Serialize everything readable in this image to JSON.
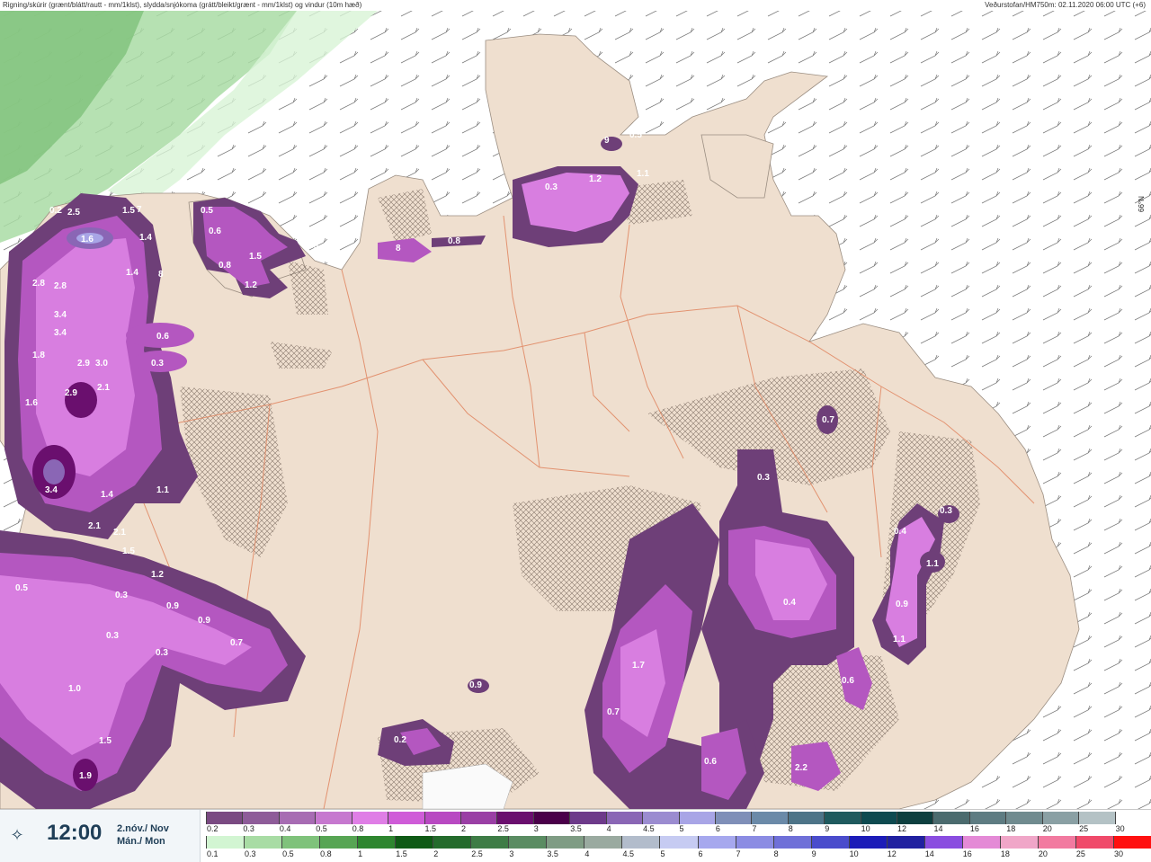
{
  "header": {
    "title": "Rigning/skúrir (grænt/blátt/rautt - mm/1klst), slydda/snjókoma (grátt/bleikt/grænt - mm/1klst) og vindur (10m hæð)",
    "source": "Veðurstofan/HM750m: 02.11.2020 06:00 UTC (+6)"
  },
  "time": {
    "icon": "clock-icon",
    "value": "12:00",
    "date_line1": "2.nóv./ Nov",
    "date_line2": "Mán./ Mon"
  },
  "lat_label": "66°N",
  "legend": {
    "snow": {
      "labels": [
        "0.2",
        "0.3",
        "0.4",
        "0.5",
        "0.8",
        "1",
        "1.5",
        "2",
        "2.5",
        "3",
        "3.5",
        "4",
        "4.5",
        "5",
        "6",
        "7",
        "8",
        "9",
        "10",
        "12",
        "14",
        "16",
        "18",
        "20",
        "25",
        "30"
      ],
      "colors": [
        "#7a4a82",
        "#8e5c99",
        "#a76cb3",
        "#c678cf",
        "#df7ee6",
        "#cf5cd8",
        "#b849c2",
        "#9a3fa5",
        "#6a0f6e",
        "#4a0049",
        "#6d3a8a",
        "#8a66b5",
        "#9b8cd0",
        "#a8a5e6",
        "#7f8fb8",
        "#6b8aa8",
        "#4d7488",
        "#1f5a5e",
        "#0e4a50",
        "#0d3f3f",
        "#4b6b6e",
        "#5e7c82",
        "#708b8f",
        "#8aa0a4",
        "#b4c2c5",
        "#ffffff"
      ]
    },
    "rain": {
      "labels": [
        "0.1",
        "0.3",
        "0.5",
        "0.8",
        "1",
        "1.5",
        "2",
        "2.5",
        "3",
        "3.5",
        "4",
        "4.5",
        "5",
        "6",
        "7",
        "8",
        "9",
        "10",
        "12",
        "14",
        "16",
        "18",
        "20",
        "25",
        "30"
      ],
      "colors": [
        "#d2f5d2",
        "#a8dca4",
        "#7fc27b",
        "#57a554",
        "#2e862f",
        "#0f5a15",
        "#246b2c",
        "#3e7c46",
        "#5a8c62",
        "#7f9c84",
        "#9aaaa0",
        "#b2bccb",
        "#c6cbf2",
        "#a6a8ee",
        "#8b8ce3",
        "#6f70d8",
        "#4a4ccc",
        "#1c1cb8",
        "#2020a0",
        "#8a4de0",
        "#e48ad6",
        "#f0a6c8",
        "#f27aa0",
        "#f04a6a",
        "#ff1010"
      ]
    }
  },
  "map_labels": [
    "0.2",
    "2.5",
    "1.5",
    "7",
    "1.6",
    "1.4",
    "1.4",
    "2.8",
    "2.8",
    "3.4",
    "3.4",
    "1.8",
    "2.9",
    "3.0",
    "2.9",
    "2.1",
    "1.6",
    "3.4",
    "1.4",
    "1.1",
    "2.1",
    "2.1",
    "1.5",
    "1.2",
    "0.3",
    "0.9",
    "0.9",
    "0.7",
    "0.3",
    "0.3",
    "1.0",
    "1.5",
    "1.9",
    "0.5",
    "0.6",
    "0.3",
    "0.5",
    "0.6",
    "0.8",
    "1.5",
    "1.2",
    "0.8",
    "8",
    "8",
    "0.8",
    "0.3",
    "1.2",
    "1.1",
    "9",
    "0.5",
    "0.7",
    "0.3",
    "0.3",
    "0.4",
    "1.1",
    "0.4",
    "0.9",
    "1.1",
    "1.7",
    "0.7",
    "0.6",
    "0.9",
    "0.2",
    "0.6",
    "2.2",
    "0.6"
  ]
}
